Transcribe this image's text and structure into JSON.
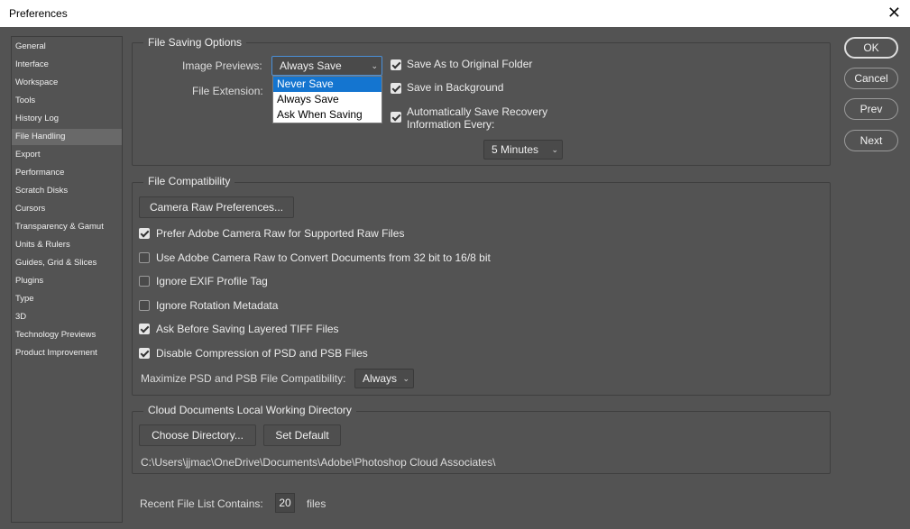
{
  "window": {
    "title": "Preferences",
    "close_glyph": "✕"
  },
  "sidebar": {
    "items": [
      {
        "label": "General"
      },
      {
        "label": "Interface"
      },
      {
        "label": "Workspace"
      },
      {
        "label": "Tools"
      },
      {
        "label": "History Log"
      },
      {
        "label": "File Handling",
        "active": true
      },
      {
        "label": "Export"
      },
      {
        "label": "Performance"
      },
      {
        "label": "Scratch Disks"
      },
      {
        "label": "Cursors"
      },
      {
        "label": "Transparency & Gamut"
      },
      {
        "label": "Units & Rulers"
      },
      {
        "label": "Guides, Grid & Slices"
      },
      {
        "label": "Plugins"
      },
      {
        "label": "Type"
      },
      {
        "label": "3D"
      },
      {
        "label": "Technology Previews"
      },
      {
        "label": "Product Improvement"
      }
    ]
  },
  "file_saving": {
    "title": "File Saving Options",
    "image_previews_label": "Image Previews:",
    "image_previews_value": "Always Save",
    "dropdown_options": [
      "Never Save",
      "Always Save",
      "Ask When Saving"
    ],
    "dropdown_highlighted": "Never Save",
    "file_extension_label": "File Extension:",
    "save_as_original": {
      "label": "Save As to Original Folder",
      "checked": true
    },
    "save_background": {
      "label": "Save in Background",
      "checked": true
    },
    "auto_recovery": {
      "label_line1": "Automatically Save Recovery",
      "label_line2": "Information Every:",
      "checked": true
    },
    "recovery_interval": "5 Minutes"
  },
  "file_compat": {
    "title": "File Compatibility",
    "camera_raw_button": "Camera Raw Preferences...",
    "options": [
      {
        "label": "Prefer Adobe Camera Raw for Supported Raw Files",
        "checked": true
      },
      {
        "label": "Use Adobe Camera Raw to Convert Documents from 32 bit to 16/8 bit",
        "checked": false
      },
      {
        "label": "Ignore EXIF Profile Tag",
        "checked": false
      },
      {
        "label": "Ignore Rotation Metadata",
        "checked": false
      },
      {
        "label": "Ask Before Saving Layered TIFF Files",
        "checked": true
      },
      {
        "label": "Disable Compression of PSD and PSB Files",
        "checked": true
      }
    ],
    "maximize_label": "Maximize PSD and PSB File Compatibility:",
    "maximize_value": "Always"
  },
  "cloud": {
    "title": "Cloud Documents Local Working Directory",
    "choose_button": "Choose Directory...",
    "default_button": "Set Default",
    "path": "C:\\Users\\jjmac\\OneDrive\\Documents\\Adobe\\Photoshop Cloud Associates\\"
  },
  "recent": {
    "label": "Recent File List Contains:",
    "value": "20",
    "suffix": "files"
  },
  "buttons": {
    "ok": "OK",
    "cancel": "Cancel",
    "prev": "Prev",
    "next": "Next"
  },
  "icons": {
    "caret": "chevron-down-icon",
    "close": "close-icon"
  }
}
